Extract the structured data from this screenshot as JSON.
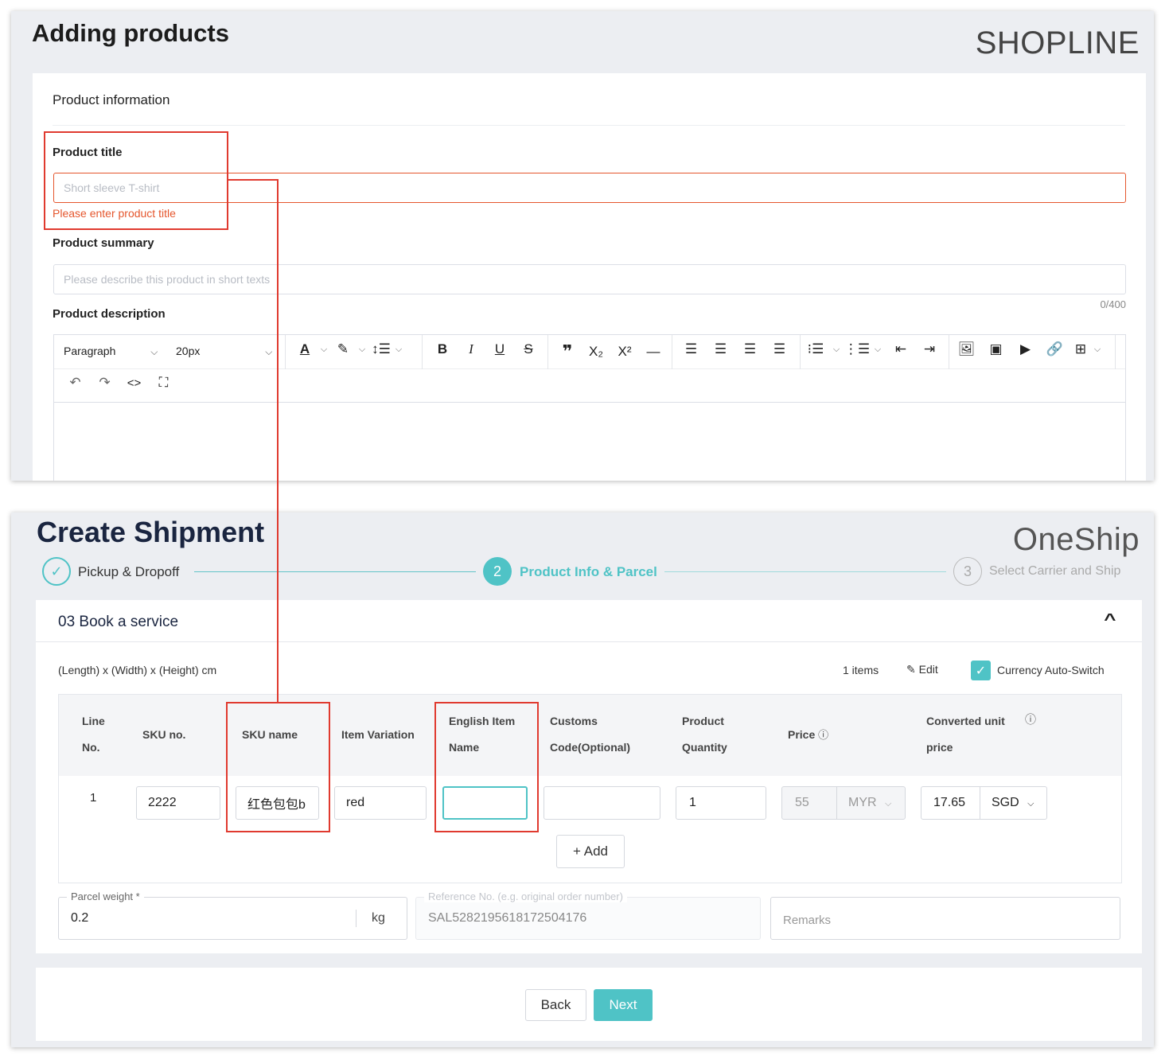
{
  "top_panel": {
    "title": "Adding products",
    "brand": "SHOPLINE",
    "section_title": "Product information",
    "product_title": {
      "label": "Product title",
      "placeholder": "Short sleeve T-shirt",
      "error": "Please enter product title"
    },
    "product_summary": {
      "label": "Product summary",
      "placeholder": "Please describe this product in short texts",
      "counter": "0/400"
    },
    "product_description": {
      "label": "Product description",
      "paragraph_select": "Paragraph",
      "size_select": "20px",
      "toolbar_icons": [
        "font-color-icon",
        "highlight-icon",
        "line-height-icon",
        "bold-icon",
        "italic-icon",
        "underline-icon",
        "strikethrough-icon",
        "quote-icon",
        "subscript-icon",
        "superscript-icon",
        "horizontal-rule-icon",
        "align-left-icon",
        "align-center-icon",
        "align-right-icon",
        "justify-icon",
        "bullet-list-icon",
        "numbered-list-icon",
        "outdent-icon",
        "indent-icon",
        "image-icon",
        "gallery-icon",
        "video-icon",
        "link-icon",
        "table-icon",
        "undo-icon",
        "redo-icon",
        "code-icon",
        "fullscreen-icon"
      ]
    }
  },
  "bottom_panel": {
    "title": "Create Shipment",
    "brand": "OneShip",
    "steps": [
      {
        "label": "Pickup & Dropoff",
        "state": "done"
      },
      {
        "number": "2",
        "label": "Product Info & Parcel",
        "state": "active"
      },
      {
        "number": "3",
        "label": "Select Carrier and Ship",
        "state": "pending"
      }
    ],
    "section": "03 Book a service",
    "dimensions": "(Length) x (Width) x (Height) cm",
    "items_count": "1 items",
    "edit_label": "Edit",
    "currency_switch": "Currency Auto-Switch",
    "table": {
      "headers": {
        "line_no": [
          "Line",
          "No."
        ],
        "sku_no": "SKU no.",
        "sku_name": "SKU name",
        "item_variation": "Item Variation",
        "english_name": [
          "English Item",
          "Name"
        ],
        "customs_code": [
          "Customs",
          "Code(Optional)"
        ],
        "product_quantity": [
          "Product",
          "Quantity"
        ],
        "price": "Price",
        "converted_price": [
          "Converted unit",
          "price"
        ]
      },
      "row": {
        "line": "1",
        "sku_no": "2222",
        "sku_name": "红色包包b",
        "item_variation": "red",
        "english_name": "",
        "customs_code": "",
        "quantity": "1",
        "price": "55",
        "price_currency": "MYR",
        "converted_price": "17.65",
        "converted_currency": "SGD"
      },
      "add_button": "+ Add"
    },
    "parcel_weight": {
      "label": "Parcel weight *",
      "value": "0.2",
      "unit": "kg"
    },
    "reference_no": {
      "label": "Reference No. (e.g. original order number)",
      "value": "SAL5282195618172504176"
    },
    "remarks": {
      "placeholder": "Remarks"
    },
    "back_button": "Back",
    "next_button": "Next"
  },
  "colors": {
    "teal": "#4fc3c6",
    "error_red": "#e5562d",
    "annotation_red": "#e03a2f"
  }
}
